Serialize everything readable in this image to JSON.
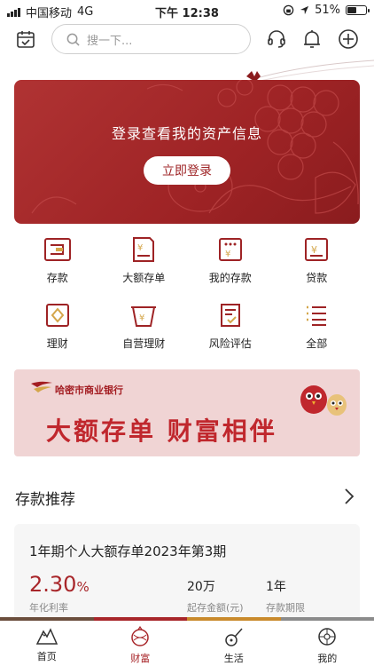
{
  "status_bar": {
    "carrier": "中国移动",
    "network": "4G",
    "time": "下午 12:38",
    "battery": "51%",
    "battery_level": 0.51
  },
  "top_bar": {
    "search_placeholder": "搜一下..."
  },
  "banner": {
    "title": "登录查看我的资产信息",
    "login_button": "立即登录"
  },
  "services": [
    {
      "label": "存款",
      "icon": "deposit-icon"
    },
    {
      "label": "大额存单",
      "icon": "large-deposit-icon"
    },
    {
      "label": "我的存款",
      "icon": "my-deposit-icon"
    },
    {
      "label": "贷款",
      "icon": "loan-icon"
    },
    {
      "label": "理财",
      "icon": "wealth-icon"
    },
    {
      "label": "自营理财",
      "icon": "self-wealth-icon"
    },
    {
      "label": "风险评估",
      "icon": "risk-icon"
    },
    {
      "label": "全部",
      "icon": "all-icon"
    }
  ],
  "ad": {
    "bank_name": "哈密市商业银行",
    "slogan": "大额存单  财富相伴"
  },
  "recommend": {
    "title": "存款推荐",
    "product": {
      "name": "1年期个人大额存单2023年第3期",
      "rate": "2.30",
      "rate_unit": "%",
      "rate_label": "年化利率",
      "min_amount": "20万",
      "min_amount_label": "起存金额(元)",
      "term": "1年",
      "term_label": "存款期限"
    }
  },
  "tabs": [
    {
      "label": "首页",
      "icon": "mountain-icon"
    },
    {
      "label": "财富",
      "icon": "wealth-ball-icon"
    },
    {
      "label": "生活",
      "icon": "lute-icon"
    },
    {
      "label": "我的",
      "icon": "flower-icon"
    }
  ],
  "colors": {
    "brand": "#9e2325",
    "accent": "#c0272d"
  }
}
